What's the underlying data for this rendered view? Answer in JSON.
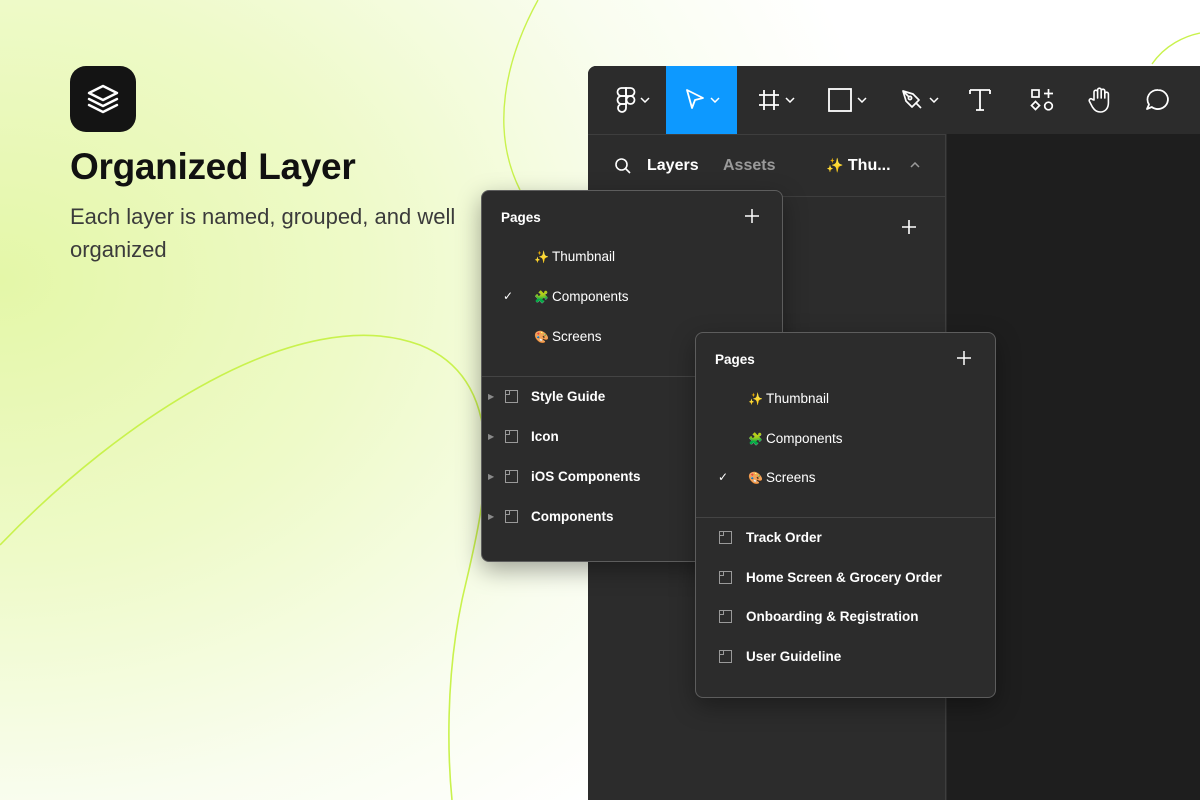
{
  "hero": {
    "title": "Organized Layer",
    "subtitle": "Each layer is named, grouped, and well organized",
    "logo_icon": "layers-stack-icon"
  },
  "toolbar": {
    "tools": [
      {
        "name": "figma-menu",
        "icon": "figma-logo-icon",
        "has_dropdown": true
      },
      {
        "name": "move-tool",
        "icon": "cursor-icon",
        "has_dropdown": true,
        "active": true
      },
      {
        "name": "frame-tool",
        "icon": "hash-frame-icon",
        "has_dropdown": true
      },
      {
        "name": "shape-tool",
        "icon": "rectangle-icon",
        "has_dropdown": true
      },
      {
        "name": "pen-tool",
        "icon": "pen-icon",
        "has_dropdown": true
      },
      {
        "name": "text-tool",
        "icon": "text-icon",
        "has_dropdown": false
      },
      {
        "name": "resources-tool",
        "icon": "resources-icon",
        "has_dropdown": false
      },
      {
        "name": "hand-tool",
        "icon": "hand-icon",
        "has_dropdown": false
      },
      {
        "name": "comment-tool",
        "icon": "comment-icon",
        "has_dropdown": false
      }
    ],
    "accent": "#0d99ff"
  },
  "panel": {
    "tab_layers": "Layers",
    "tab_assets": "Assets",
    "page_emoji": "✨",
    "page_name": "Thu..."
  },
  "popover_back": {
    "heading": "Pages",
    "pages": [
      {
        "emoji": "✨",
        "label": "Thumbnail",
        "checked": false
      },
      {
        "emoji": "🧩",
        "label": "Components",
        "checked": true
      },
      {
        "emoji": "🎨",
        "label": "Screens",
        "checked": false
      }
    ],
    "layers": [
      "Style Guide",
      "Icon",
      "iOS Components",
      "Components"
    ]
  },
  "popover_front": {
    "heading": "Pages",
    "pages": [
      {
        "emoji": "✨",
        "label": "Thumbnail",
        "checked": false
      },
      {
        "emoji": "🧩",
        "label": "Components",
        "checked": false
      },
      {
        "emoji": "🎨",
        "label": "Screens",
        "checked": true
      }
    ],
    "layers": [
      "Track Order",
      "Home Screen & Grocery Order",
      "Onboarding & Registration",
      "User Guideline"
    ]
  },
  "check_glyph": "✓"
}
